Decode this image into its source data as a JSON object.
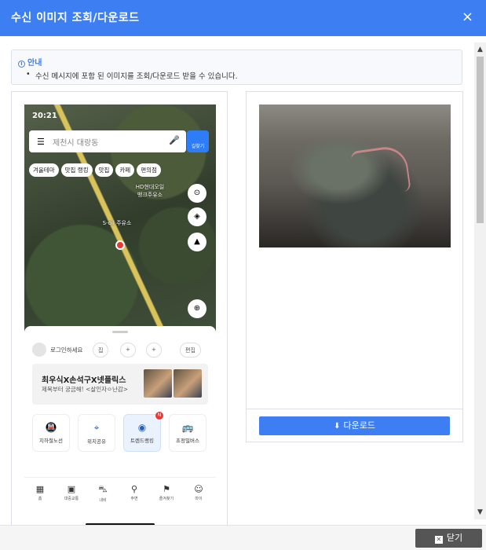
{
  "dialog": {
    "title": "수신 이미지 조회/다운로드",
    "close_glyph": "×"
  },
  "notice": {
    "heading": "안내",
    "text": "수신 메시지에 포함 된 이미지를 조회/다운로드 받을 수 있습니다."
  },
  "map_screenshot": {
    "status_time": "20:21",
    "search_placeholder": "제천시 대랑동",
    "route_label": "길찾기",
    "chips": [
      "겨울테마",
      "맛집 랭킹",
      "맛집",
      "카페",
      "편의점"
    ],
    "map_labels": [
      "HD현대오일뱅크주유소",
      "S-oil 주유소"
    ],
    "login_text": "로그인하세요",
    "pills": [
      "집",
      "+",
      "+",
      "편집"
    ],
    "promo_title": "최우식X손석구X넷플릭스",
    "promo_subtitle": "제목부터 궁금해! <살인자ㅇ난감>",
    "tiles": [
      "지하철노선",
      "위치공유",
      "트렌드랭킹",
      "초정밀버스"
    ],
    "tile_badge": "N",
    "nav": [
      "홈",
      "대중교통",
      "내비",
      "주변",
      "즐겨찾기",
      "마이"
    ]
  },
  "download": {
    "label": "다운로드",
    "icon": "download-icon"
  },
  "footer": {
    "close_label": "닫기"
  },
  "colors": {
    "accent": "#3d7ff3",
    "close_button": "#555555"
  }
}
